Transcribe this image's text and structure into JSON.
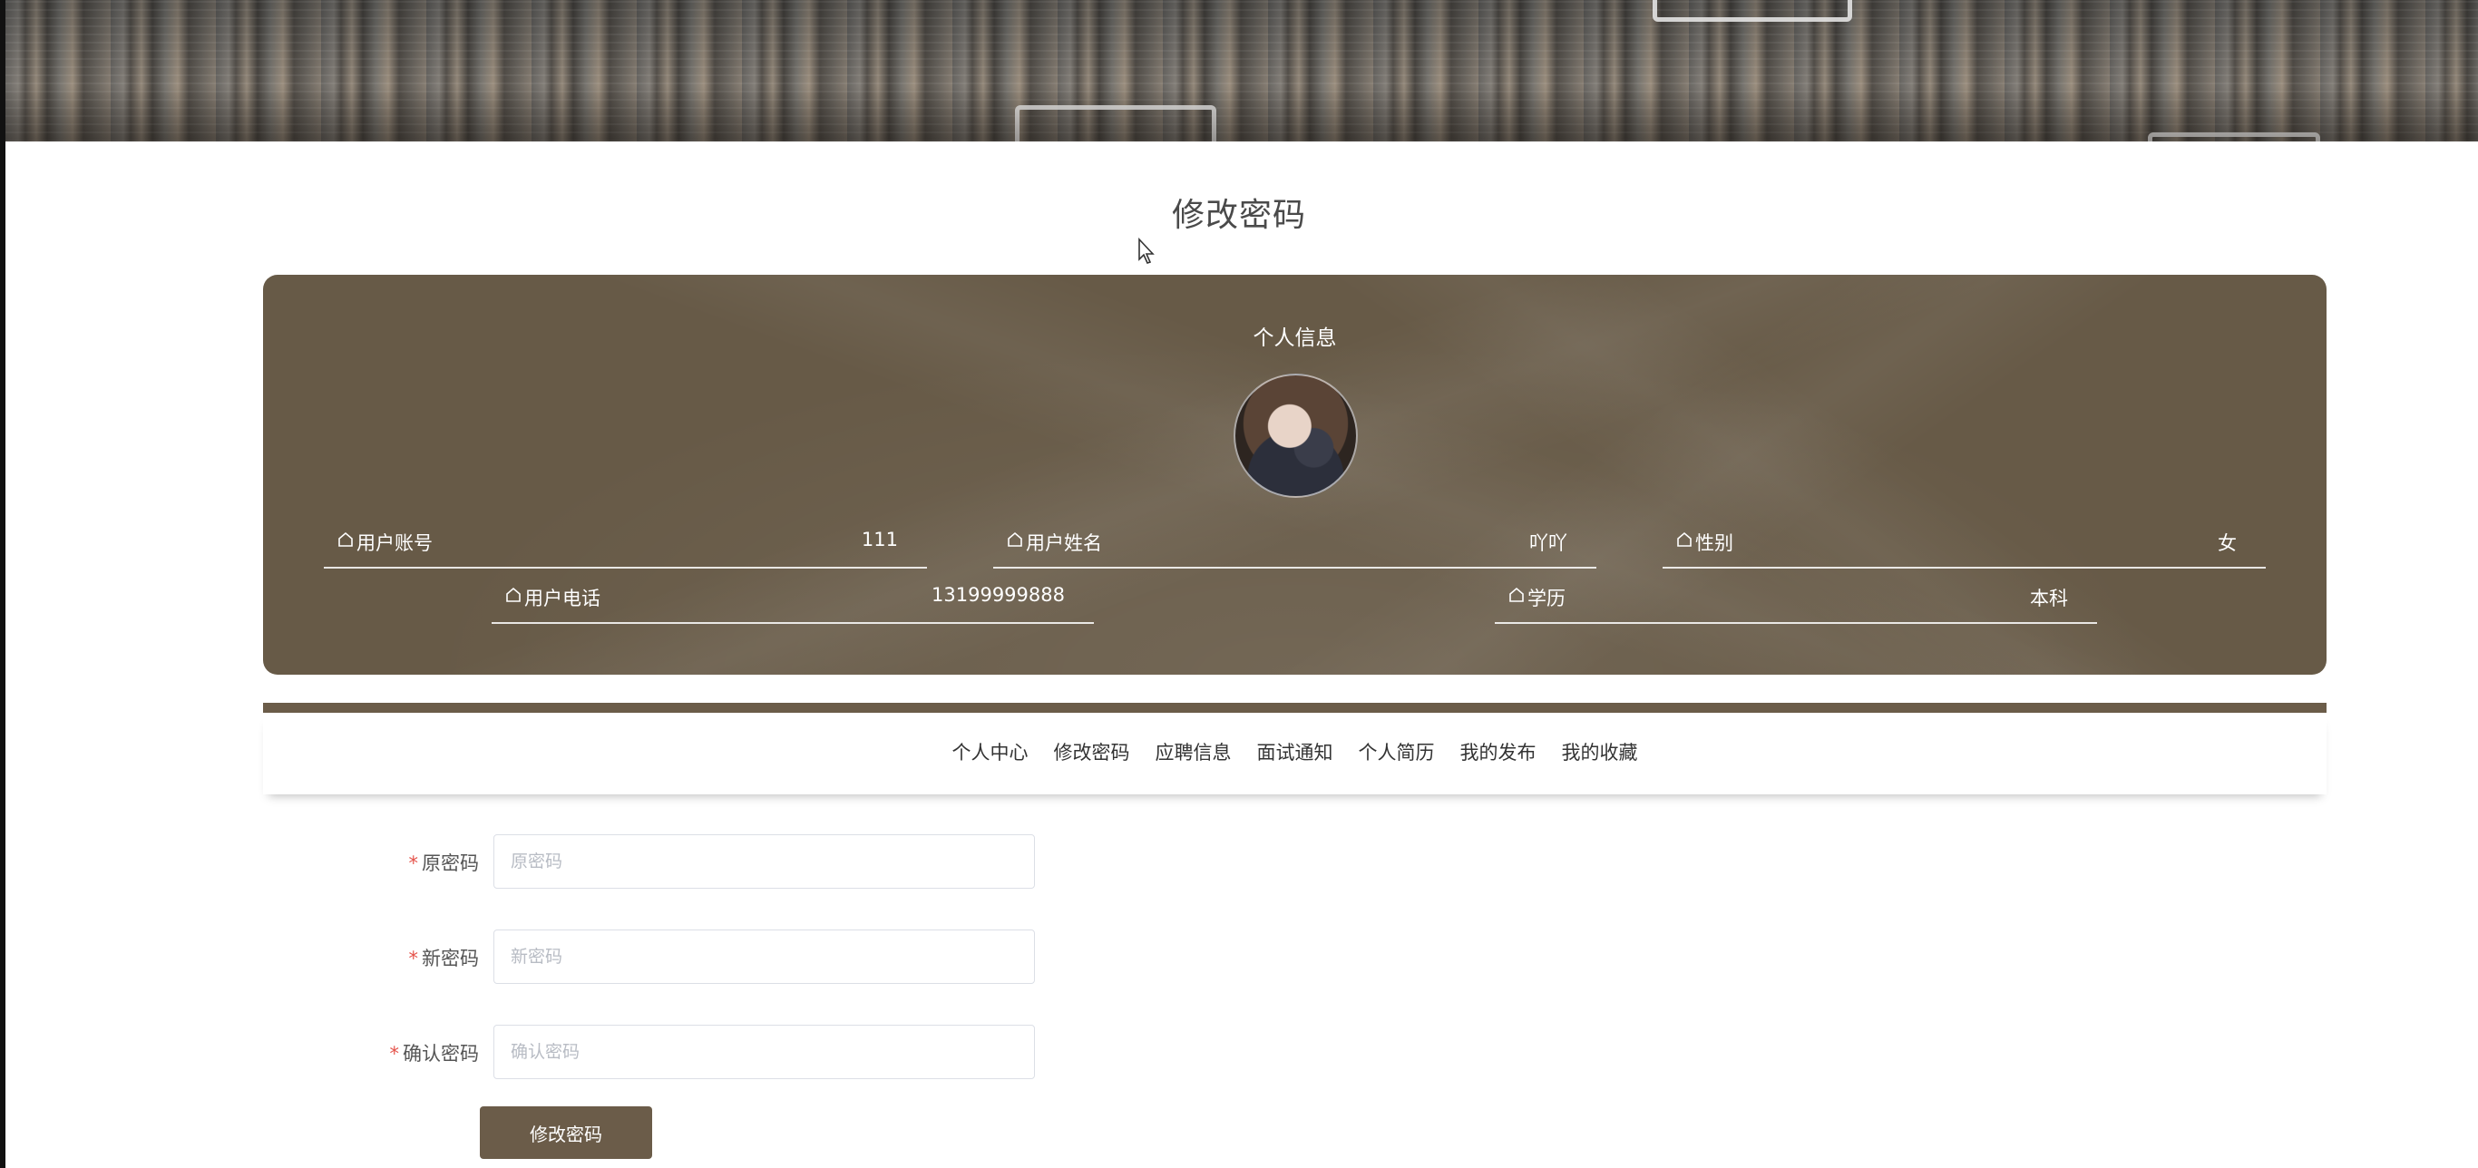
{
  "page_title": "修改密码",
  "info": {
    "title": "个人信息",
    "fields": [
      {
        "label": "用户账号",
        "value": "111"
      },
      {
        "label": "用户姓名",
        "value": "吖吖"
      },
      {
        "label": "性别",
        "value": "女"
      },
      {
        "label": "用户电话",
        "value": "13199999888"
      },
      {
        "label": "学历",
        "value": "本科"
      }
    ]
  },
  "tabs": [
    "个人中心",
    "修改密码",
    "应聘信息",
    "面试通知",
    "个人简历",
    "我的发布",
    "我的收藏"
  ],
  "form": {
    "old_password": {
      "label": "原密码",
      "placeholder": "原密码"
    },
    "new_password": {
      "label": "新密码",
      "placeholder": "新密码"
    },
    "confirm_password": {
      "label": "确认密码",
      "placeholder": "确认密码"
    },
    "submit_label": "修改密码"
  },
  "colors": {
    "primary": "#6b5c49",
    "required": "#e5534b"
  }
}
